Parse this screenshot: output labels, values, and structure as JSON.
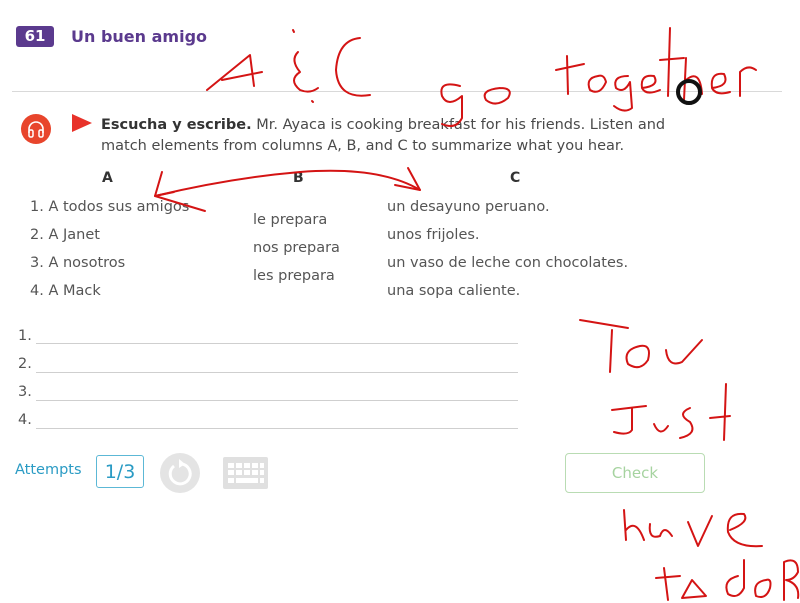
{
  "header": {
    "lesson_number": "61",
    "lesson_title": "Un buen amigo"
  },
  "activity": {
    "instruction_bold": "Escucha y escribe.",
    "instruction_text": " Mr. Ayaca is cooking breakfast for his friends. Listen and match elements from columns A, B, and C to summarize what you hear.",
    "columns": {
      "A": {
        "header": "A",
        "items": [
          "1. A todos sus amigos",
          "2. A Janet",
          "3. A nosotros",
          "4. A Mack"
        ]
      },
      "B": {
        "header": "B",
        "items": [
          "le prepara",
          "nos prepara",
          "les prepara"
        ]
      },
      "C": {
        "header": "C",
        "items": [
          "un desayuno peruano.",
          "unos frijoles.",
          "un vaso de leche con chocolates.",
          "una sopa caliente."
        ]
      }
    },
    "answers": [
      {
        "number": "1.",
        "value": ""
      },
      {
        "number": "2.",
        "value": ""
      },
      {
        "number": "3.",
        "value": ""
      },
      {
        "number": "4.",
        "value": ""
      }
    ]
  },
  "footer": {
    "attempts_label": "Attempts",
    "attempts_value": "1/3",
    "check_label": "Check"
  },
  "annotations": {
    "line1": "A & C",
    "line2": "go together",
    "line3": "You Just have to do"
  },
  "colors": {
    "brand_purple": "#5b3a8e",
    "audio_red": "#e8452c",
    "link_blue": "#2a9bc4",
    "check_green": "#a6d3a0",
    "annotation_red": "#d41414"
  }
}
